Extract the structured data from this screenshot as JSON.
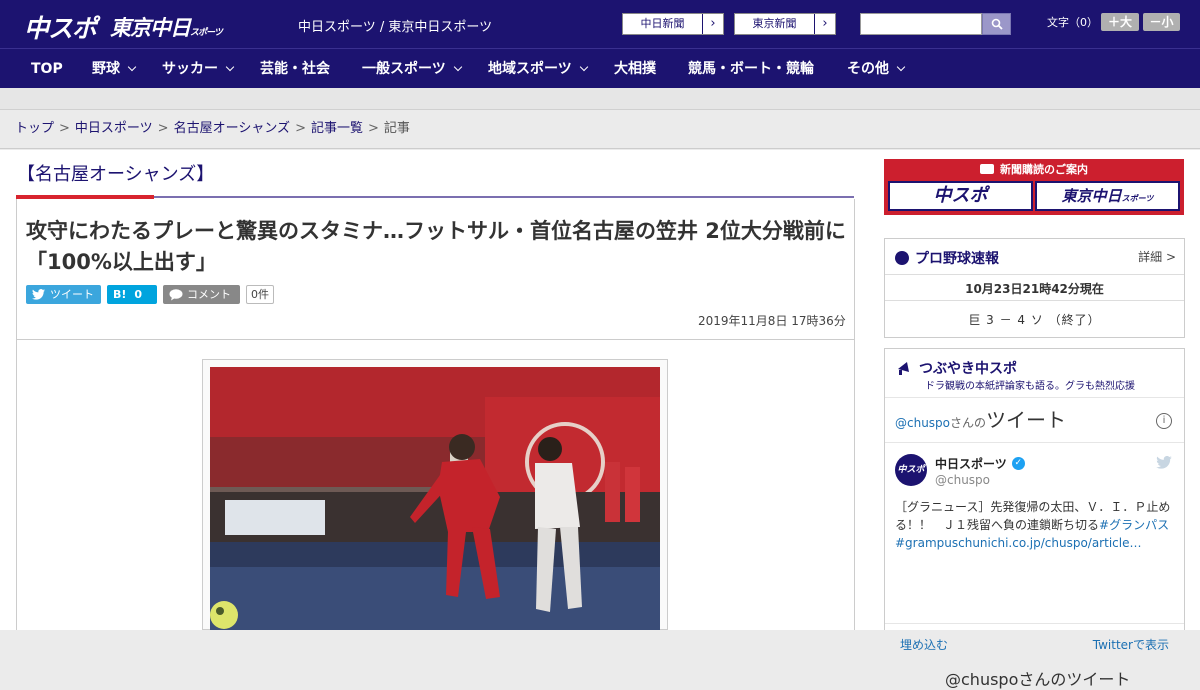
{
  "header": {
    "logo_main": "中スポ",
    "logo_tokyo": "東京中日",
    "logo_tokyo_sub": "スポーツ",
    "site_names": "中日スポーツ / 東京中日スポーツ",
    "paper_buttons": [
      {
        "label": "中日新聞",
        "icon": "chevron-right-icon"
      },
      {
        "label": "東京新聞",
        "icon": "chevron-right-icon"
      }
    ],
    "search_placeholder": "",
    "search_icon": "search-icon",
    "font_size_label": "文字（0）",
    "font_larger": "＋大",
    "font_smaller": "－小"
  },
  "nav": {
    "items": [
      {
        "label": "TOP",
        "dropdown": false
      },
      {
        "label": "野球",
        "dropdown": true
      },
      {
        "label": "サッカー",
        "dropdown": true
      },
      {
        "label": "芸能・社会",
        "dropdown": false
      },
      {
        "label": "一般スポーツ",
        "dropdown": true
      },
      {
        "label": "地域スポーツ",
        "dropdown": true
      },
      {
        "label": "大相撲",
        "dropdown": false
      },
      {
        "label": "競馬・ボート・競輪",
        "dropdown": false
      },
      {
        "label": "その他",
        "dropdown": true
      }
    ]
  },
  "breadcrumb": {
    "items": [
      "トップ",
      "中日スポーツ",
      "名古屋オーシャンズ",
      "記事一覧"
    ],
    "current": "記事",
    "separator": ">"
  },
  "article": {
    "category": "【名古屋オーシャンズ】",
    "headline": "攻守にわたるプレーと驚異のスタミナ…フットサル・首位名古屋の笠井 2位大分戦前に「100%以上出す」",
    "share": {
      "tweet_label": "ツイート",
      "hatena_label": "B!",
      "hatena_count": "0",
      "comment_label": "コメント",
      "comment_count": "0件"
    },
    "date": "2019年11月8日 17時36分",
    "photo_alt": "photo"
  },
  "sidebar": {
    "ad": {
      "title": "新聞購読のご案内",
      "btn_main": "中スポ",
      "btn_tokyo": "東京中日",
      "btn_tokyo_sub": "スポーツ"
    },
    "baseball": {
      "title": "プロ野球速報",
      "detail": "詳細 >",
      "timestamp": "10月23日21時42分現在",
      "score": "巨 3 － 4 ソ （終了）"
    },
    "tsubuyaki": {
      "title": "つぶやき中スポ",
      "subtitle": "ドラ観戦の本紙評論家も語る。グラも熱烈応援",
      "embed_user": "@chuspo",
      "embed_user_suffix": "さんの",
      "embed_heading": "ツイート",
      "info": "i",
      "account_name": "中日スポーツ",
      "account_handle": "@chuspo",
      "avatar_text": "中スポ",
      "tweet_text": "［グラニュース］先発復帰の太田、Ｖ．Ｉ．Ｐ止める！！　Ｊ１残留へ負の連鎖断ち切る",
      "tweet_hashtag": "#グランパス",
      "tweet_link": "#grampuschunichi.co.jp/chuspo/article…",
      "embed_link": "埋め込む",
      "view_on_twitter": "Twitterで表示",
      "next_heading": "@chuspoさんのツイート"
    }
  },
  "colors": {
    "brand_navy": "#1c1370",
    "accent_red": "#d8242e",
    "link_blue": "#1c70b3"
  }
}
